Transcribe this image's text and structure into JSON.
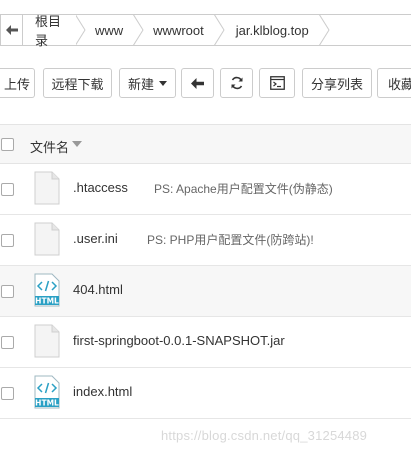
{
  "breadcrumb": {
    "items": [
      "根目录",
      "www",
      "wwwroot",
      "jar.klblog.top"
    ]
  },
  "toolbar": {
    "upload": "上传",
    "remote_download": "远程下载",
    "new": "新建",
    "share_list": "分享列表",
    "favorites": "收藏"
  },
  "table": {
    "header": "文件名",
    "rows": [
      {
        "name": ".htaccess",
        "note": "PS: Apache用户配置文件(伪静态)",
        "icon": "generic-file-icon"
      },
      {
        "name": ".user.ini",
        "note": "PS: PHP用户配置文件(防跨站)!",
        "icon": "generic-file-icon"
      },
      {
        "name": "404.html",
        "note": "",
        "icon": "html-file-icon"
      },
      {
        "name": "first-springboot-0.0.1-SNAPSHOT.jar",
        "note": "",
        "icon": "generic-file-icon"
      },
      {
        "name": "index.html",
        "note": "",
        "icon": "html-file-icon"
      }
    ]
  },
  "html_badge": "HTML",
  "watermark": "https://blog.csdn.net/qq_31254489",
  "colors": {
    "border": "#cccccc",
    "header_bg": "#f7f7f7",
    "html_icon_accent": "#2aa0c4"
  }
}
